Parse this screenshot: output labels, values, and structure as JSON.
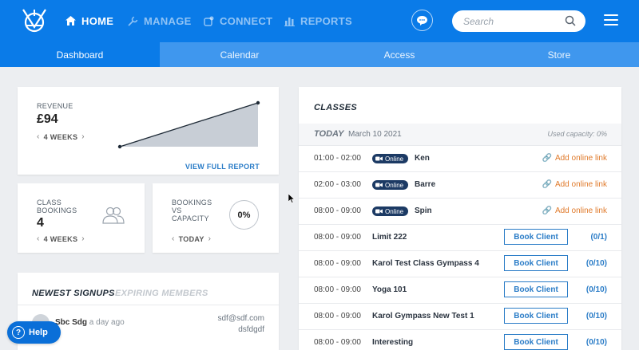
{
  "nav": {
    "items": [
      {
        "label": "HOME",
        "icon": "home-icon",
        "active": true
      },
      {
        "label": "MANAGE",
        "icon": "wrench-icon",
        "active": false
      },
      {
        "label": "CONNECT",
        "icon": "connect-icon",
        "active": false
      },
      {
        "label": "REPORTS",
        "icon": "chart-icon",
        "active": false
      }
    ],
    "search_placeholder": "Search"
  },
  "subtabs": [
    "Dashboard",
    "Calendar",
    "Access",
    "Store"
  ],
  "revenue": {
    "label": "REVENUE",
    "value": "£94",
    "period": "4 WEEKS",
    "link": "VIEW FULL REPORT"
  },
  "class_bookings": {
    "label": "CLASS BOOKINGS",
    "value": "4",
    "period": "4 WEEKS"
  },
  "bookings_capacity": {
    "label": "BOOKINGS VS CAPACITY",
    "value": "0%",
    "period": "TODAY"
  },
  "signups": {
    "tab_active": "NEWEST SIGNUPS",
    "tab_inactive": "EXPIRING MEMBERS",
    "items": [
      {
        "name": "Sbc Sdg",
        "when": "a day ago",
        "email": "sdf@sdf.com",
        "extra": "dsfdgdf"
      }
    ]
  },
  "classes": {
    "title": "CLASSES",
    "today_label": "TODAY",
    "date": "March 10 2021",
    "capacity": "Used capacity: 0%",
    "online_label": "Online",
    "add_link_label": "Add online link",
    "book_label": "Book Client",
    "rows": [
      {
        "time": "01:00 - 02:00",
        "name": "Ken",
        "online": true
      },
      {
        "time": "02:00 - 03:00",
        "name": "Barre",
        "online": true
      },
      {
        "time": "08:00 - 09:00",
        "name": "Spin",
        "online": true
      },
      {
        "time": "08:00 - 09:00",
        "name": "Limit 222",
        "online": false,
        "count": "(0/1)"
      },
      {
        "time": "08:00 - 09:00",
        "name": "Karol Test Class Gympass 4",
        "online": false,
        "count": "(0/10)"
      },
      {
        "time": "08:00 - 09:00",
        "name": "Yoga 101",
        "online": false,
        "count": "(0/10)"
      },
      {
        "time": "08:00 - 09:00",
        "name": "Karol Gympass New Test 1",
        "online": false,
        "count": "(0/10)"
      },
      {
        "time": "08:00 - 09:00",
        "name": "Interesting",
        "online": false,
        "count": "(0/10)"
      }
    ]
  },
  "help": {
    "label": "Help"
  },
  "colors": {
    "brand": "#0a7be8",
    "subtab": "#3f97ee",
    "accent": "#2a7cc7",
    "online_badge": "#1c3a64",
    "add_link": "#e07a2b"
  }
}
